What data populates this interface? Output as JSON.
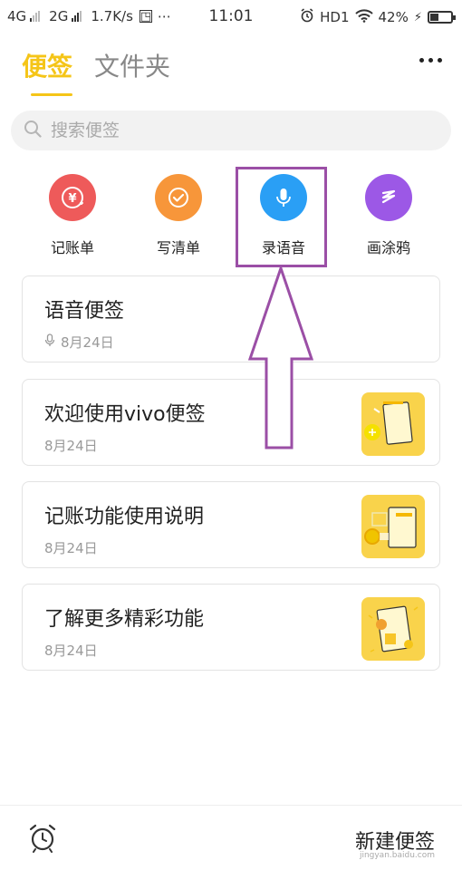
{
  "status_bar": {
    "net1": "4G",
    "net2": "2G",
    "speed": "1.7K/s",
    "time": "11:01",
    "hd": "HD1",
    "battery_percent": "42%",
    "battery_level": 0.42
  },
  "header": {
    "tabs": [
      {
        "label": "便签",
        "active": true
      },
      {
        "label": "文件夹",
        "active": false
      }
    ],
    "more_icon": "more-dots-icon"
  },
  "search": {
    "placeholder": "搜索便签"
  },
  "quick_actions": [
    {
      "label": "记账单",
      "icon": "yen-icon",
      "color": "#ee5a5a"
    },
    {
      "label": "写清单",
      "icon": "check-icon",
      "color": "#f7963a"
    },
    {
      "label": "录语音",
      "icon": "microphone-icon",
      "color": "#2a9ff5"
    },
    {
      "label": "画涂鸦",
      "icon": "scribble-icon",
      "color": "#9c58e6"
    }
  ],
  "notes": [
    {
      "title": "语音便签",
      "date": "8月24日",
      "has_mic": true
    },
    {
      "title": "欢迎使用vivo便签",
      "date": "8月24日"
    },
    {
      "title": "记账功能使用说明",
      "date": "8月24日"
    },
    {
      "title": "了解更多精彩功能",
      "date": "8月24日"
    }
  ],
  "bottom_bar": {
    "alarm_icon": "alarm-clock-icon",
    "new_note": "新建便签",
    "watermark": "jingyan.baidu.com"
  },
  "colors": {
    "accent": "#f5c518",
    "annotation": "#9b4fa6"
  }
}
